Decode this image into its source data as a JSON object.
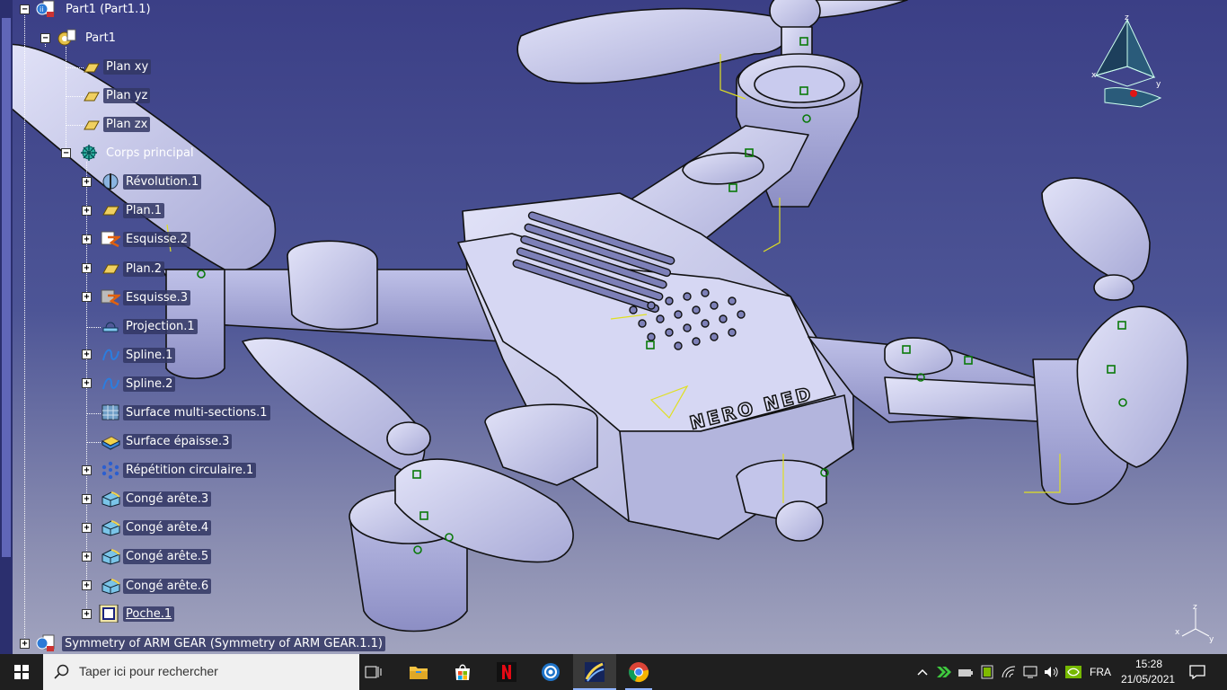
{
  "tree": {
    "nodes": [
      {
        "label": "Part1 (Part1.1)",
        "icon": "product-icon",
        "expander": "−"
      },
      {
        "label": "Part1",
        "icon": "part-icon",
        "expander": "−"
      },
      {
        "label": "Plan xy",
        "icon": "plane-icon",
        "expander": ""
      },
      {
        "label": "Plan yz",
        "icon": "plane-icon",
        "expander": ""
      },
      {
        "label": "Plan zx",
        "icon": "plane-icon",
        "expander": ""
      },
      {
        "label": "Corps principal",
        "icon": "body-gear-icon",
        "expander": "−"
      },
      {
        "label": "Révolution.1",
        "icon": "revolution-icon",
        "expander": "+"
      },
      {
        "label": "Plan.1",
        "icon": "plane-icon",
        "expander": "+"
      },
      {
        "label": "Esquisse.2",
        "icon": "sketch-icon",
        "expander": "+"
      },
      {
        "label": "Plan.2",
        "icon": "plane-icon",
        "expander": "+"
      },
      {
        "label": "Esquisse.3",
        "icon": "sketch-icon",
        "expander": "+"
      },
      {
        "label": "Projection.1",
        "icon": "projection-icon",
        "expander": ""
      },
      {
        "label": "Spline.1",
        "icon": "spline-icon",
        "expander": "+"
      },
      {
        "label": "Spline.2",
        "icon": "spline-icon",
        "expander": "+"
      },
      {
        "label": "Surface multi-sections.1",
        "icon": "multi-section-surface-icon",
        "expander": ""
      },
      {
        "label": "Surface épaisse.3",
        "icon": "thick-surface-icon",
        "expander": ""
      },
      {
        "label": "Répétition circulaire.1",
        "icon": "circular-pattern-icon",
        "expander": "+"
      },
      {
        "label": "Congé arête.3",
        "icon": "edge-fillet-icon",
        "expander": "+"
      },
      {
        "label": "Congé arête.4",
        "icon": "edge-fillet-icon",
        "expander": "+"
      },
      {
        "label": "Congé arête.5",
        "icon": "edge-fillet-icon",
        "expander": "+"
      },
      {
        "label": "Congé arête.6",
        "icon": "edge-fillet-icon",
        "expander": "+"
      },
      {
        "label": "Poche.1",
        "icon": "pocket-icon",
        "expander": "+"
      },
      {
        "label": "Symmetry of ARM GEAR (Symmetry of ARM GEAR.1.1)",
        "icon": "product-icon",
        "expander": "+"
      }
    ]
  },
  "model": {
    "brand_text": "NERO NED"
  },
  "compass": {
    "x": "x",
    "y": "y",
    "z": "z"
  },
  "axis_mini": {
    "x": "x",
    "y": "y",
    "z": "z"
  },
  "taskbar": {
    "search_placeholder": "Taper ici pour rechercher",
    "apps": [
      "task-view-icon",
      "file-explorer-icon",
      "store-icon",
      "netflix-icon",
      "photos-icon",
      "catia-icon",
      "chrome-icon"
    ],
    "language": "FRA",
    "time": "15:28",
    "date": "21/05/2021"
  }
}
